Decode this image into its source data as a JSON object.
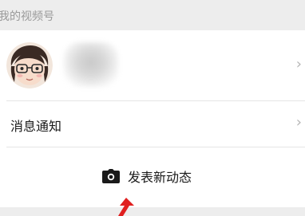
{
  "section": {
    "title": "我的视频号"
  },
  "profile": {
    "avatar_icon": "cartoon-avatar-icon",
    "chevron_icon": "chevron-right-icon",
    "chevron_glyph": "›"
  },
  "notifications": {
    "label": "消息通知",
    "chevron_glyph": "›"
  },
  "post": {
    "label": "发表新动态",
    "icon": "camera-icon"
  },
  "colors": {
    "background": "#ededed",
    "card": "#ffffff",
    "text": "#1a1a1a",
    "muted": "#9a9a9a",
    "annotation_arrow": "#e02020"
  }
}
